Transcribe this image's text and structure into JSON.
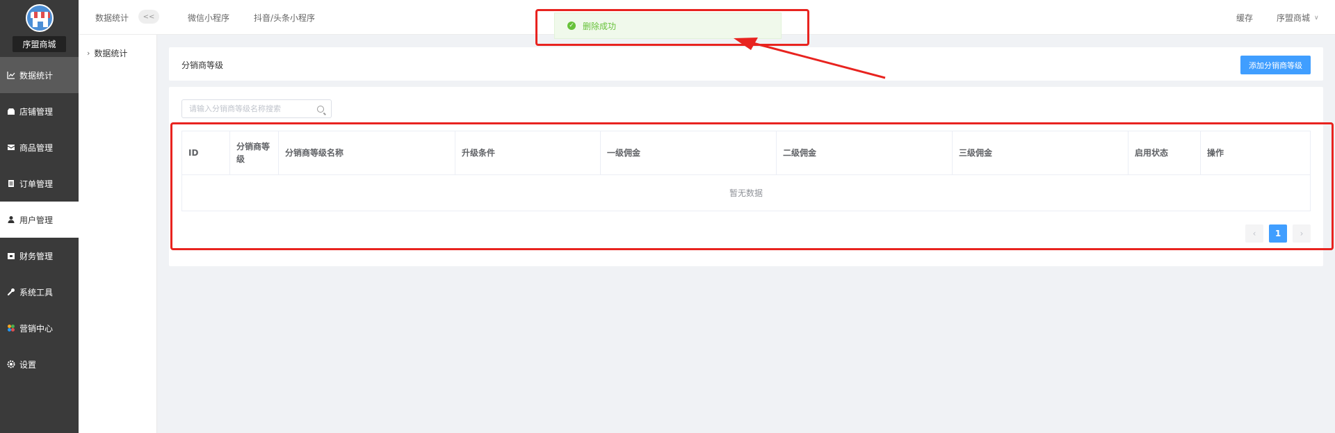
{
  "sidebar": {
    "shop_name": "序盟商城",
    "items": [
      {
        "label": "数据统计",
        "icon": "chart-line-icon"
      },
      {
        "label": "店铺管理",
        "icon": "shop-icon"
      },
      {
        "label": "商品管理",
        "icon": "goods-icon"
      },
      {
        "label": "订单管理",
        "icon": "order-icon"
      },
      {
        "label": "用户管理",
        "icon": "user-icon"
      },
      {
        "label": "财务管理",
        "icon": "finance-icon"
      },
      {
        "label": "系统工具",
        "icon": "wrench-icon"
      },
      {
        "label": "营销中心",
        "icon": "marketing-icon"
      },
      {
        "label": "设置",
        "icon": "gear-icon"
      }
    ]
  },
  "subsidebar": {
    "item": "数据统计"
  },
  "topbar": {
    "breadcrumb": "数据统计",
    "collapse": "<<",
    "tabs": [
      "微信小程序",
      "抖音/头条小程序"
    ],
    "cache": "缓存",
    "user": "序盟商城"
  },
  "toast": {
    "message": "删除成功"
  },
  "page": {
    "title": "分销商等级",
    "add_button": "添加分销商等级",
    "search_placeholder": "请输入分销商等级名称搜索"
  },
  "table": {
    "columns": [
      "ID",
      "分销商等级",
      "分销商等级名称",
      "升级条件",
      "一级佣金",
      "二级佣金",
      "三级佣金",
      "启用状态",
      "操作"
    ],
    "empty_text": "暂无数据"
  },
  "pagination": {
    "current": "1",
    "prev": "‹",
    "next": "›"
  },
  "colors": {
    "primary": "#409eff",
    "success": "#67c23a",
    "sidebar": "#3a3a3a",
    "annotation": "#e8231f"
  }
}
